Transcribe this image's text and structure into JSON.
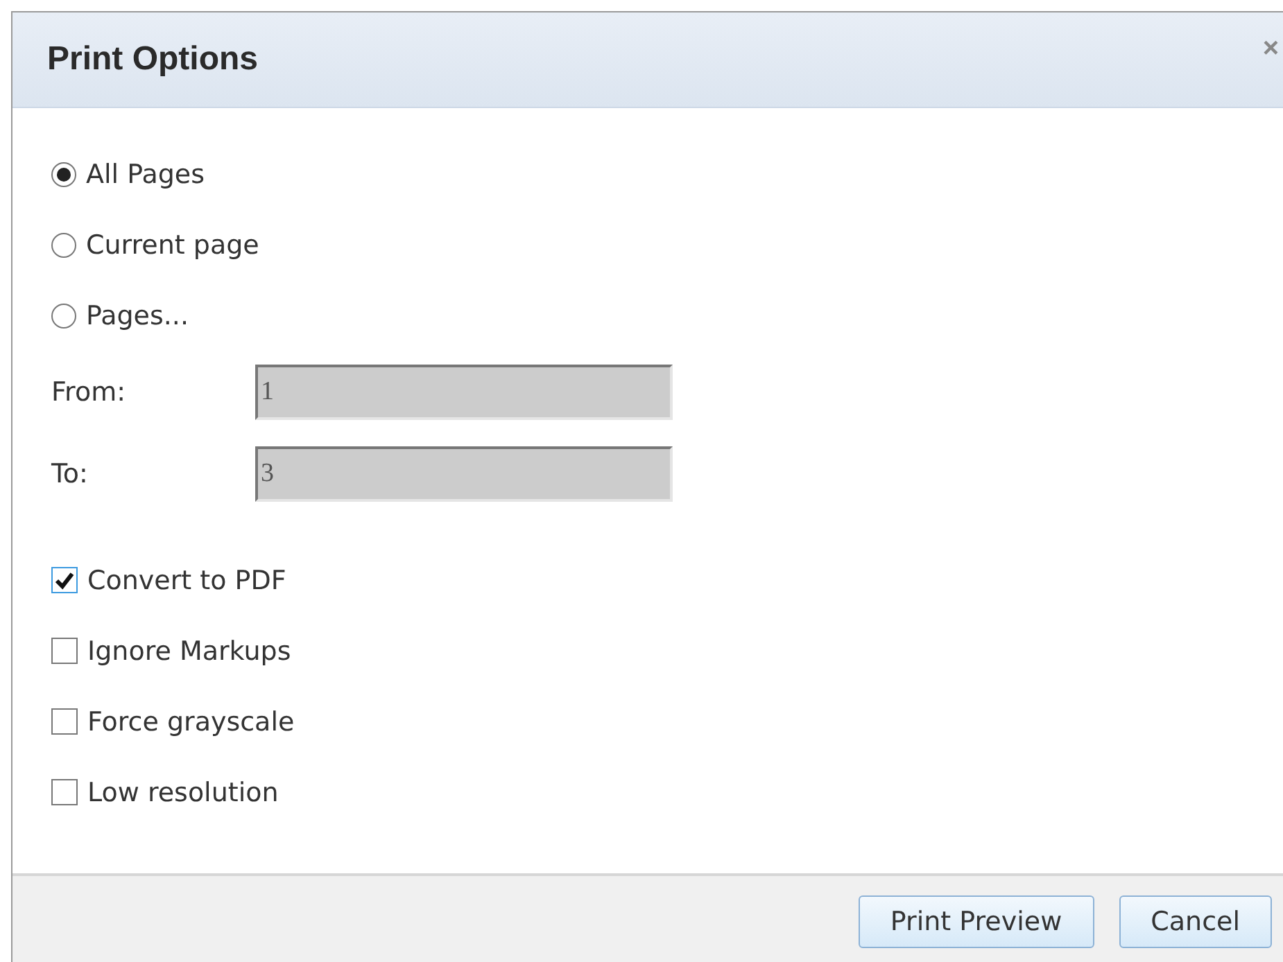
{
  "dialog": {
    "title": "Print Options",
    "close": "×"
  },
  "page_range": [
    {
      "label": "All Pages",
      "selected": true
    },
    {
      "label": "Current page",
      "selected": false
    },
    {
      "label": "Pages...",
      "selected": false
    }
  ],
  "fields": [
    {
      "label": "From:",
      "value": "1",
      "disabled": true
    },
    {
      "label": "To:",
      "value": "3",
      "disabled": true
    }
  ],
  "options": [
    {
      "label": "Convert to PDF",
      "checked": true
    },
    {
      "label": "Ignore Markups",
      "checked": false
    },
    {
      "label": "Force grayscale",
      "checked": false
    },
    {
      "label": "Low resolution",
      "checked": false
    }
  ],
  "buttons": [
    "Print Preview",
    "Cancel"
  ]
}
